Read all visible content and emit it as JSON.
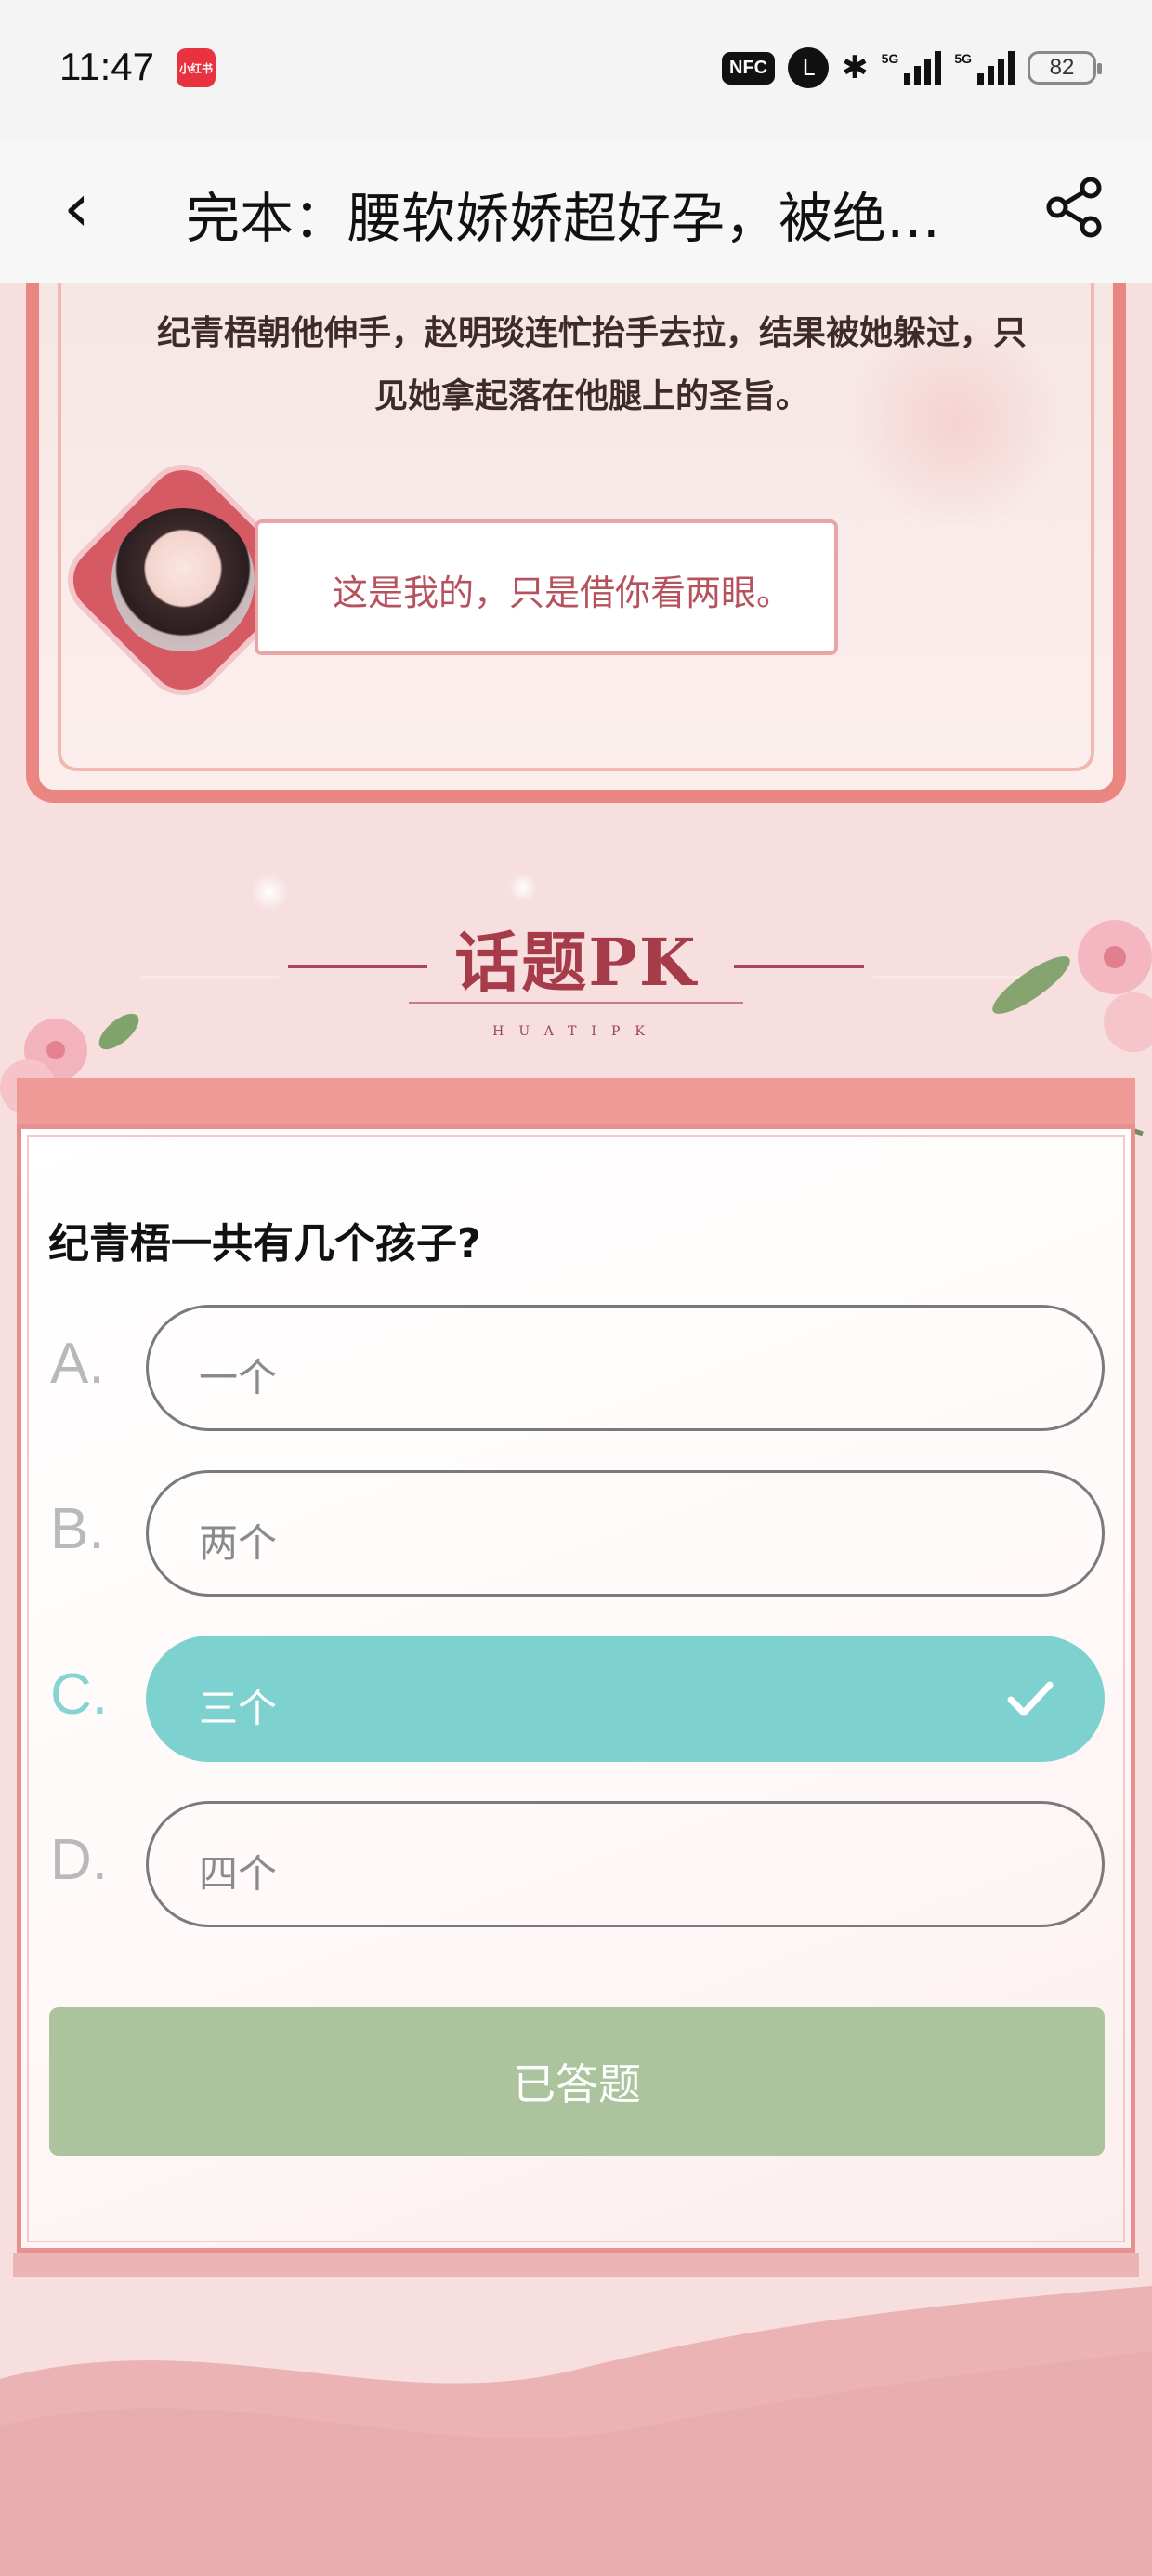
{
  "status_bar": {
    "time": "11:47",
    "app_badge": "小红书",
    "nfc": "NFC",
    "alarm_glyph": "L",
    "signal1": "5G",
    "signal2": "5G",
    "battery": "82"
  },
  "nav": {
    "title": "完本：腰软娇娇超好孕，被绝…",
    "back_glyph": "‹"
  },
  "story": {
    "narration": "纪青梧朝他伸手，赵明琰连忙抬手去拉，结果被她躲过，只见她拿起落在他腿上的圣旨。",
    "dialogue": "这是我的，只是借你看两眼。"
  },
  "topic": {
    "title": "话题PK",
    "subtitle": "HUATIPK"
  },
  "quiz": {
    "question": "纪青梧一共有几个孩子?",
    "options": [
      {
        "letter": "A.",
        "text": "一个",
        "selected": false
      },
      {
        "letter": "B.",
        "text": "两个",
        "selected": false
      },
      {
        "letter": "C.",
        "text": "三个",
        "selected": true
      },
      {
        "letter": "D.",
        "text": "四个",
        "selected": false
      }
    ],
    "submit_label": "已答题"
  },
  "colors": {
    "accent_teal": "#7dd1ce",
    "answered_green": "#abc49d",
    "frame_pink": "#e98682",
    "title_red": "#a63b4a"
  },
  "icons": [
    "back-icon",
    "share-icon",
    "check-icon",
    "bluetooth-icon",
    "alarm-icon"
  ]
}
